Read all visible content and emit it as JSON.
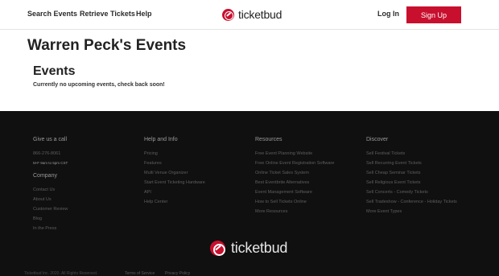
{
  "header": {
    "nav": [
      "Search Events",
      "Retrieve Tickets",
      "Help"
    ],
    "logo_text": "ticketbud",
    "login_label": "Log In",
    "signup_label": "Sign Up",
    "accent_color": "#c8102e"
  },
  "main": {
    "page_title": "Warren Peck's Events",
    "section_title": "Events",
    "empty_message": "Currently no upcoming events, check back soon!"
  },
  "footer": {
    "call": {
      "heading": "Give us a call",
      "phone": "866-276-8061",
      "hours": "M-F 9am to 5pm CST"
    },
    "company": {
      "heading": "Company",
      "items": [
        "Contact Us",
        "About Us",
        "Customer Review",
        "Blog",
        "In the Press"
      ]
    },
    "help": {
      "heading": "Help and Info",
      "items": [
        "Pricing",
        "Features",
        "Multi Venue Organizer",
        "Start Event Ticketing Hardware",
        "API",
        "Help Center"
      ]
    },
    "resources": {
      "heading": "Resources",
      "items": [
        "Free Event Planning Website",
        "Free Online Event Registration Software",
        "Online Ticket Sales System",
        "Best Eventbrite Alternatives",
        "Event Management Software",
        "How to Sell Tickets Online",
        "More Resources"
      ]
    },
    "discover": {
      "heading": "Discover",
      "items": [
        "Sell Festival Tickets",
        "Sell Recurring Event Tickets",
        "Sell Cheap Seminar Tickets",
        "Sell Religious Event Tickets",
        "Sell Concerts - Comedy Tickets",
        "Sell Tradeshow - Conference - Holiday Tickets",
        "More Event Types"
      ]
    },
    "logo_text": "ticketbud",
    "copyright": "Ticketbud Inc. 2020. All Rights Reserved.",
    "terms_label": "Terms of Service",
    "privacy_label": "Privacy Policy"
  }
}
